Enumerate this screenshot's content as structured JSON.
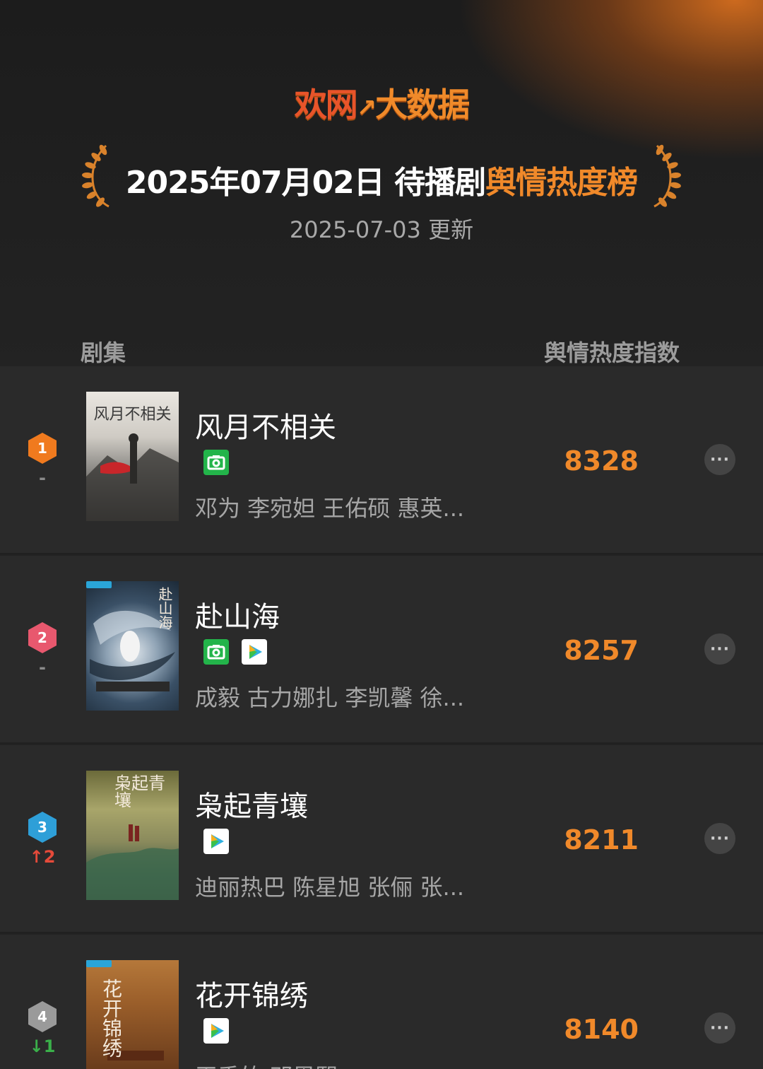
{
  "header": {
    "brand_red": "欢网",
    "brand_mark": "↗",
    "brand_orange": "大数据",
    "title_prefix": "2025年07月02日 待播剧",
    "title_highlight": "舆情热度榜",
    "update_text": "2025-07-03 更新",
    "col_left": "剧集",
    "col_right": "舆情热度指数"
  },
  "colors": {
    "accent_orange": "#f0892a",
    "rank1": "#f07a1e",
    "rank2": "#e8586e",
    "rank3": "#2e9fd8",
    "rank4": "#9a9a9a",
    "up": "#e64a3a",
    "down": "#3ab04a"
  },
  "rows": [
    {
      "rank": "1",
      "change": "-",
      "title": "风月不相关",
      "poster_text": "风月不相关",
      "platforms": [
        "camera-platform-icon"
      ],
      "cast": "邓为 李宛妲 王佑硕 惠英...",
      "score": "8328",
      "more": "···"
    },
    {
      "rank": "2",
      "change": "-",
      "title": "赴山海",
      "poster_text": "赴山海",
      "platforms": [
        "camera-platform-icon",
        "play-platform-icon"
      ],
      "cast": "成毅 古力娜扎 李凯馨 徐...",
      "score": "8257",
      "more": "···"
    },
    {
      "rank": "3",
      "change": "↑2",
      "title": "枭起青壤",
      "poster_text": "枭起青壤",
      "platforms": [
        "play-platform-icon"
      ],
      "cast": "迪丽热巴 陈星旭 张俪 张...",
      "score": "8211",
      "more": "···"
    },
    {
      "rank": "4",
      "change": "↓1",
      "title": "花开锦绣",
      "poster_text": "花开锦绣",
      "platforms": [
        "play-platform-icon"
      ],
      "cast": "王秀竹 邓恩熙...",
      "score": "8140",
      "more": "···"
    }
  ]
}
